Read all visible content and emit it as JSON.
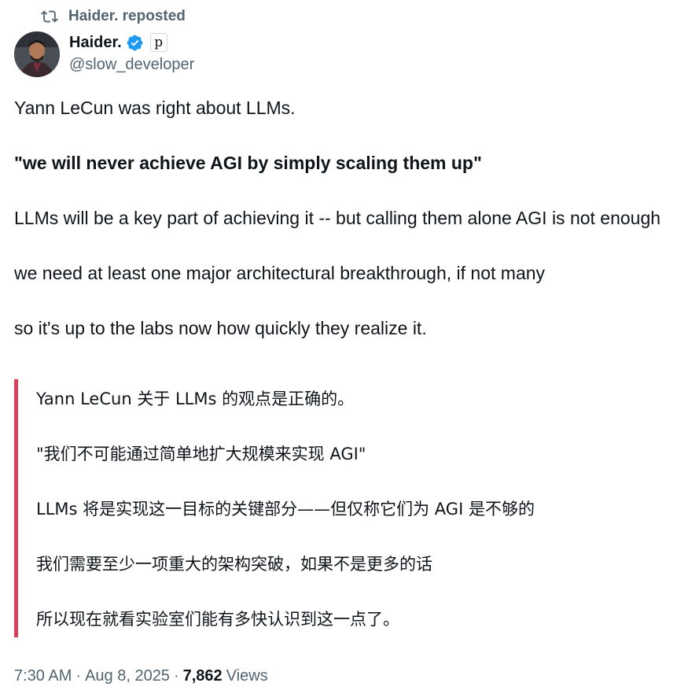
{
  "repost": {
    "label": "Haider. reposted",
    "icon": "repost-icon"
  },
  "author": {
    "display_name": "Haider.",
    "handle": "@slow_developer",
    "verified": true,
    "badge_icon": "verified-badge-icon",
    "affiliate_glyph": "p",
    "accent_color": "#1d9bf0"
  },
  "tweet": {
    "lines": [
      "Yann LeCun was right about LLMs.",
      "\"we will never achieve AGI by simply scaling them up\"",
      "LLMs will be a key part of achieving it -- but calling them alone AGI is not enough",
      "we need at least one major architectural breakthrough, if not many",
      "so it's up to the labs now how quickly they realize it."
    ]
  },
  "translation": {
    "bar_color": "#d9405b",
    "lines": [
      "Yann LeCun 关于 LLMs 的观点是正确的。",
      "\"我们不可能通过简单地扩大规模来实现 AGI\"",
      "LLMs 将是实现这一目标的关键部分——但仅称它们为 AGI 是不够的",
      "我们需要至少一项重大的架构突破，如果不是更多的话",
      "所以现在就看实验室们能有多快认识到这一点了。"
    ]
  },
  "meta": {
    "time": "7:30 AM",
    "date": "Aug 8, 2025",
    "separator": "·",
    "views_count": "7,862",
    "views_label": "Views"
  }
}
